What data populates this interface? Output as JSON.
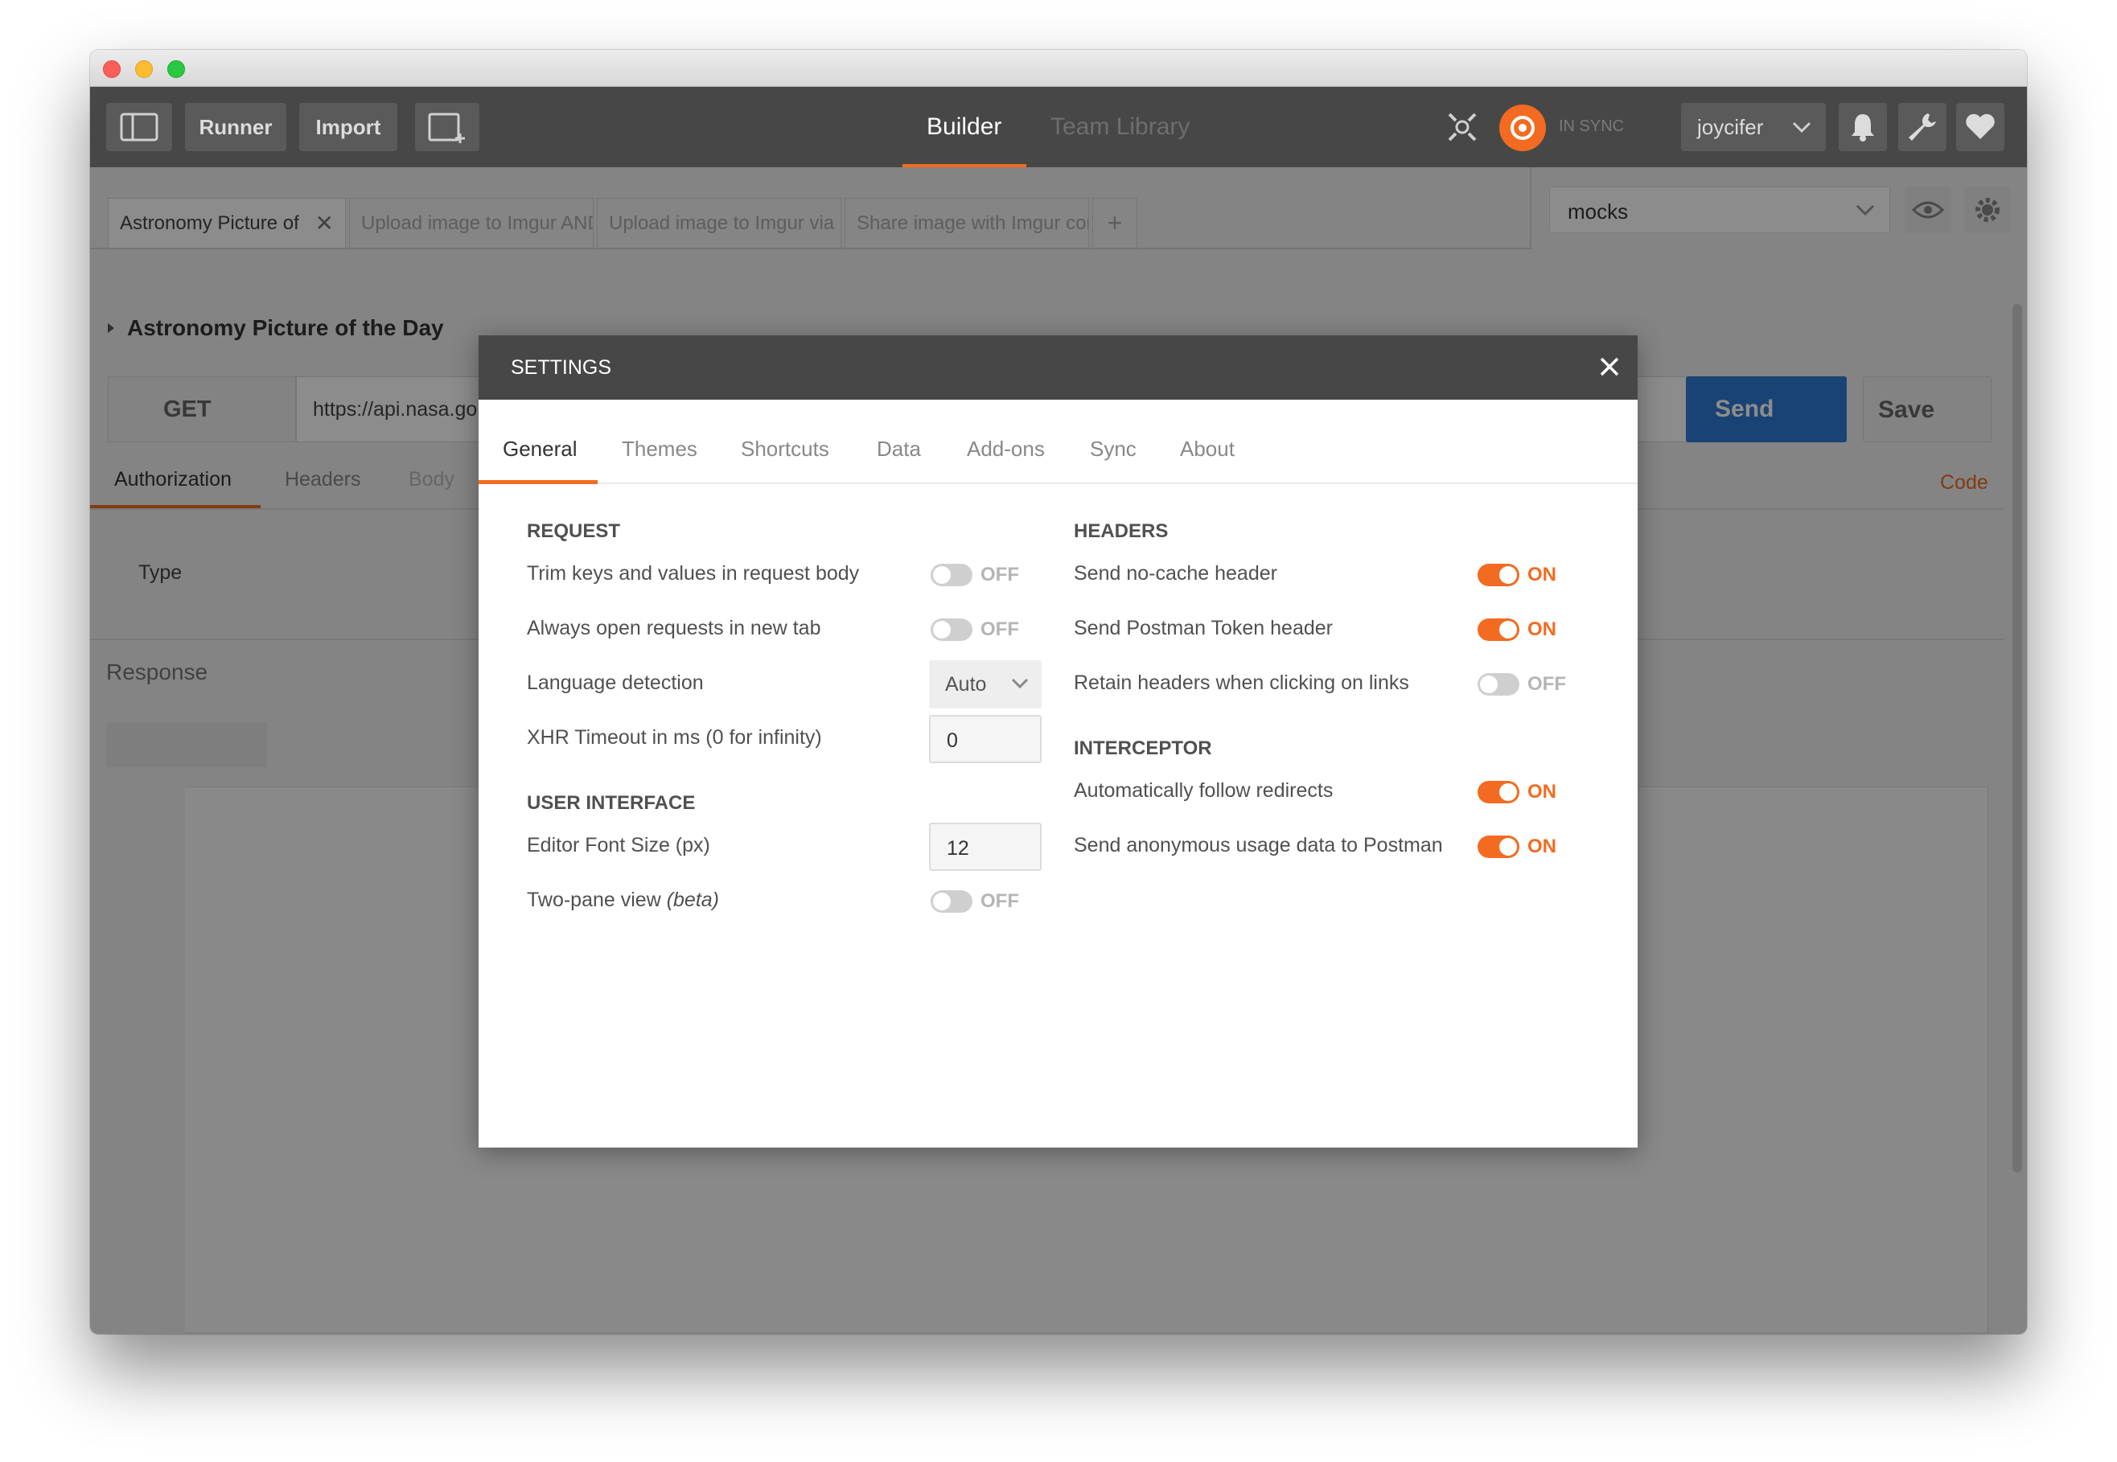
{
  "header": {
    "runner": "Runner",
    "import": "Import",
    "builder": "Builder",
    "team_library": "Team Library",
    "sync_status": "IN SYNC",
    "user": "joycifer"
  },
  "request_tabs": [
    {
      "label": "Astronomy Picture of"
    },
    {
      "label": "Upload image to Imgur AND"
    },
    {
      "label": "Upload image to Imgur via O"
    },
    {
      "label": "Share image with Imgur cor"
    }
  ],
  "environment": "mocks",
  "collection_title": "Astronomy Picture of the Day",
  "request": {
    "method": "GET",
    "url": "https://api.nasa.go",
    "send": "Send",
    "save": "Save"
  },
  "subtabs": {
    "authorization": "Authorization",
    "headers": "Headers",
    "body": "Body",
    "code": "Code"
  },
  "auth_type_label": "Type",
  "response_label": "Response",
  "settings": {
    "title": "SETTINGS",
    "tabs": [
      "General",
      "Themes",
      "Shortcuts",
      "Data",
      "Add-ons",
      "Sync",
      "About"
    ],
    "request_heading": "REQUEST",
    "trim_label": "Trim keys and values in request body",
    "trim_state": "OFF",
    "new_tab_label": "Always open requests in new tab",
    "new_tab_state": "OFF",
    "lang_label": "Language detection",
    "lang_value": "Auto",
    "xhr_label": "XHR Timeout in ms (0 for infinity)",
    "xhr_value": "0",
    "ui_heading": "USER INTERFACE",
    "font_label": "Editor Font Size (px)",
    "font_value": "12",
    "two_pane_label": "Two-pane view",
    "two_pane_beta": "(beta)",
    "two_pane_state": "OFF",
    "headers_heading": "HEADERS",
    "nocache_label": "Send no-cache header",
    "nocache_state": "ON",
    "token_label": "Send Postman Token header",
    "token_state": "ON",
    "retain_label": "Retain headers when clicking on links",
    "retain_state": "OFF",
    "interceptor_heading": "INTERCEPTOR",
    "redirect_label": "Automatically follow redirects",
    "redirect_state": "ON",
    "usage_label": "Send anonymous usage data to Postman",
    "usage_state": "ON"
  },
  "colors": {
    "accent": "#f26b21",
    "header_bg": "#474747",
    "send_blue": "#2f7bd3"
  }
}
